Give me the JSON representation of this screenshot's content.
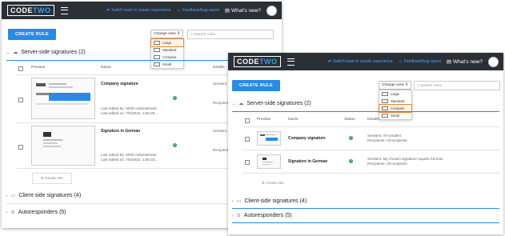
{
  "brand": {
    "code": "CODE",
    "two": "TWO"
  },
  "topbar": {
    "classic_link": "Switch back to classic experience",
    "feedback_link": "Feedback/bug report",
    "whats_new": "What's new?"
  },
  "toolbar": {
    "create_rule": "CREATE RULE",
    "change_view": "Change view ⇕",
    "search_placeholder": "Search rules"
  },
  "view_options": [
    "Large",
    "Standard",
    "Compact",
    "Small"
  ],
  "columns": {
    "preview": "Preview",
    "name": "Name",
    "status": "Status",
    "details": "Details"
  },
  "sections": {
    "server": "Server-side signatures (2)",
    "client": "Client-side signatures (4)",
    "auto": "Autoresponders (5)"
  },
  "rows": [
    {
      "name": "Company signature",
      "senders": "Senders: All senders",
      "recipients": "Recipients: All recipients",
      "edited_by": "Last edited by: MOD Administrator",
      "edited_on": "Last edited on: 7/5/2022, 1:55:28...",
      "senders_short": "Senders: All se",
      "recipients_short": "Recipients: All re"
    },
    {
      "name": "Signature in German",
      "senders": "Senders: My chosen signature equals German",
      "recipients": "Recipients: All recipients",
      "edited_by": "Last edited by: MOD Administrator",
      "edited_on": "Last edited on: 7/5/2022, 1:55:45...",
      "senders_short": "Senders: My chosen",
      "recipients_short": "Recipients: All re"
    }
  ],
  "add_rule": "Create rule",
  "colors": {
    "topbar": "#2b2f36",
    "accent": "#2a8ae6",
    "highlight": "#e8862a",
    "status_ok": "#35a853"
  }
}
